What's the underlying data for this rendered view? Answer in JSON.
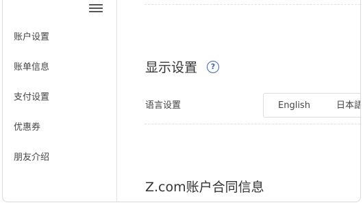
{
  "sidebar": {
    "menu_icon": "hamburger-menu-icon",
    "items": [
      {
        "label": "账户设置"
      },
      {
        "label": "账单信息"
      },
      {
        "label": "支付设置"
      },
      {
        "label": "优惠券"
      },
      {
        "label": "朋友介绍"
      }
    ]
  },
  "display_settings": {
    "title": "显示设置",
    "help_icon": "question-circle-icon",
    "help_glyph": "?",
    "language_label": "语言设置",
    "language_options": [
      {
        "label": "English"
      },
      {
        "label": "日本語"
      }
    ]
  },
  "contract_section": {
    "title": "Z.com账户合同信息"
  },
  "colors": {
    "accent": "#3a63b8",
    "border": "#dcdcdc",
    "text": "#333333"
  }
}
